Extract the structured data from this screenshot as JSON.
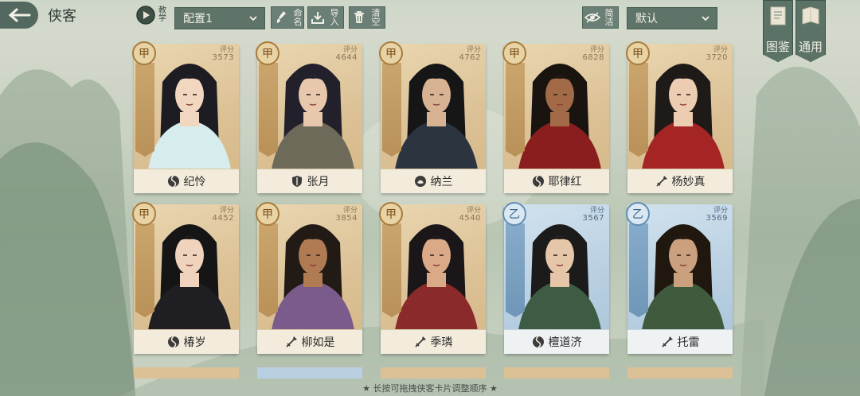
{
  "header": {
    "title": "侠客",
    "tutorial_label": "教学",
    "config_select": "配置1",
    "rename_label": "命名",
    "import_label": "导入",
    "clear_label": "清空",
    "simple_label": "简洁",
    "sort_select": "默认",
    "tabs": [
      {
        "label": "图鉴"
      },
      {
        "label": "通用"
      }
    ]
  },
  "score_label": "评分",
  "cards": [
    {
      "name": "纪怜",
      "grade": "甲",
      "score": "3573",
      "faction_icon": "swirl-icon"
    },
    {
      "name": "张月",
      "grade": "甲",
      "score": "4644",
      "faction_icon": "shield-icon"
    },
    {
      "name": "纳兰",
      "grade": "甲",
      "score": "4762",
      "faction_icon": "lotus-icon"
    },
    {
      "name": "耶律红",
      "grade": "甲",
      "score": "6828",
      "faction_icon": "swirl-icon"
    },
    {
      "name": "杨妙真",
      "grade": "甲",
      "score": "3720",
      "faction_icon": "spear-icon"
    },
    {
      "name": "椿岁",
      "grade": "甲",
      "score": "4452",
      "faction_icon": "swirl-icon"
    },
    {
      "name": "柳如是",
      "grade": "甲",
      "score": "3854",
      "faction_icon": "spear-icon"
    },
    {
      "name": "季璘",
      "grade": "甲",
      "score": "4540",
      "faction_icon": "spear-icon"
    },
    {
      "name": "檀道济",
      "grade": "乙",
      "score": "3567",
      "faction_icon": "swirl-icon"
    },
    {
      "name": "托雷",
      "grade": "乙",
      "score": "3569",
      "faction_icon": "spear-icon"
    }
  ],
  "hint": "★ 长按可拖拽侠客卡片调整顺序 ★",
  "colors": {
    "jia_card": "#dcc196",
    "yi_card": "#b9d0e2",
    "toolbar": "#5f7469"
  }
}
